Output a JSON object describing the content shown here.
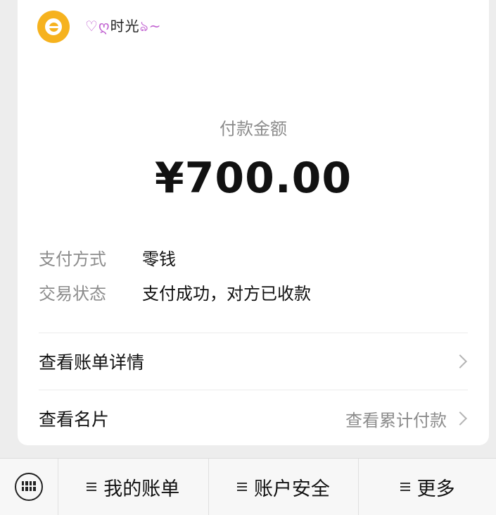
{
  "merchant": {
    "name": "时光",
    "deco_left": "♡ღ",
    "deco_right": "ঌ~"
  },
  "payment": {
    "amount_label": "付款金额",
    "amount": "¥700.00"
  },
  "details": [
    {
      "key": "支付方式",
      "value": "零钱"
    },
    {
      "key": "交易状态",
      "value": "支付成功，对方已收款"
    }
  ],
  "links": {
    "bill_details": "查看账单详情",
    "business_card": "查看名片",
    "cumulative_payment": "查看累计付款"
  },
  "menu": {
    "items": [
      "我的账单",
      "账户安全",
      "更多"
    ]
  },
  "colors": {
    "logo": "#f6b21e",
    "background": "#ededed"
  },
  "icons": {
    "merchant_logo": "merchant-logo-icon",
    "keyboard": "keyboard-icon",
    "chevron": "chevron-right-icon",
    "menu": "menu-lines-icon"
  }
}
